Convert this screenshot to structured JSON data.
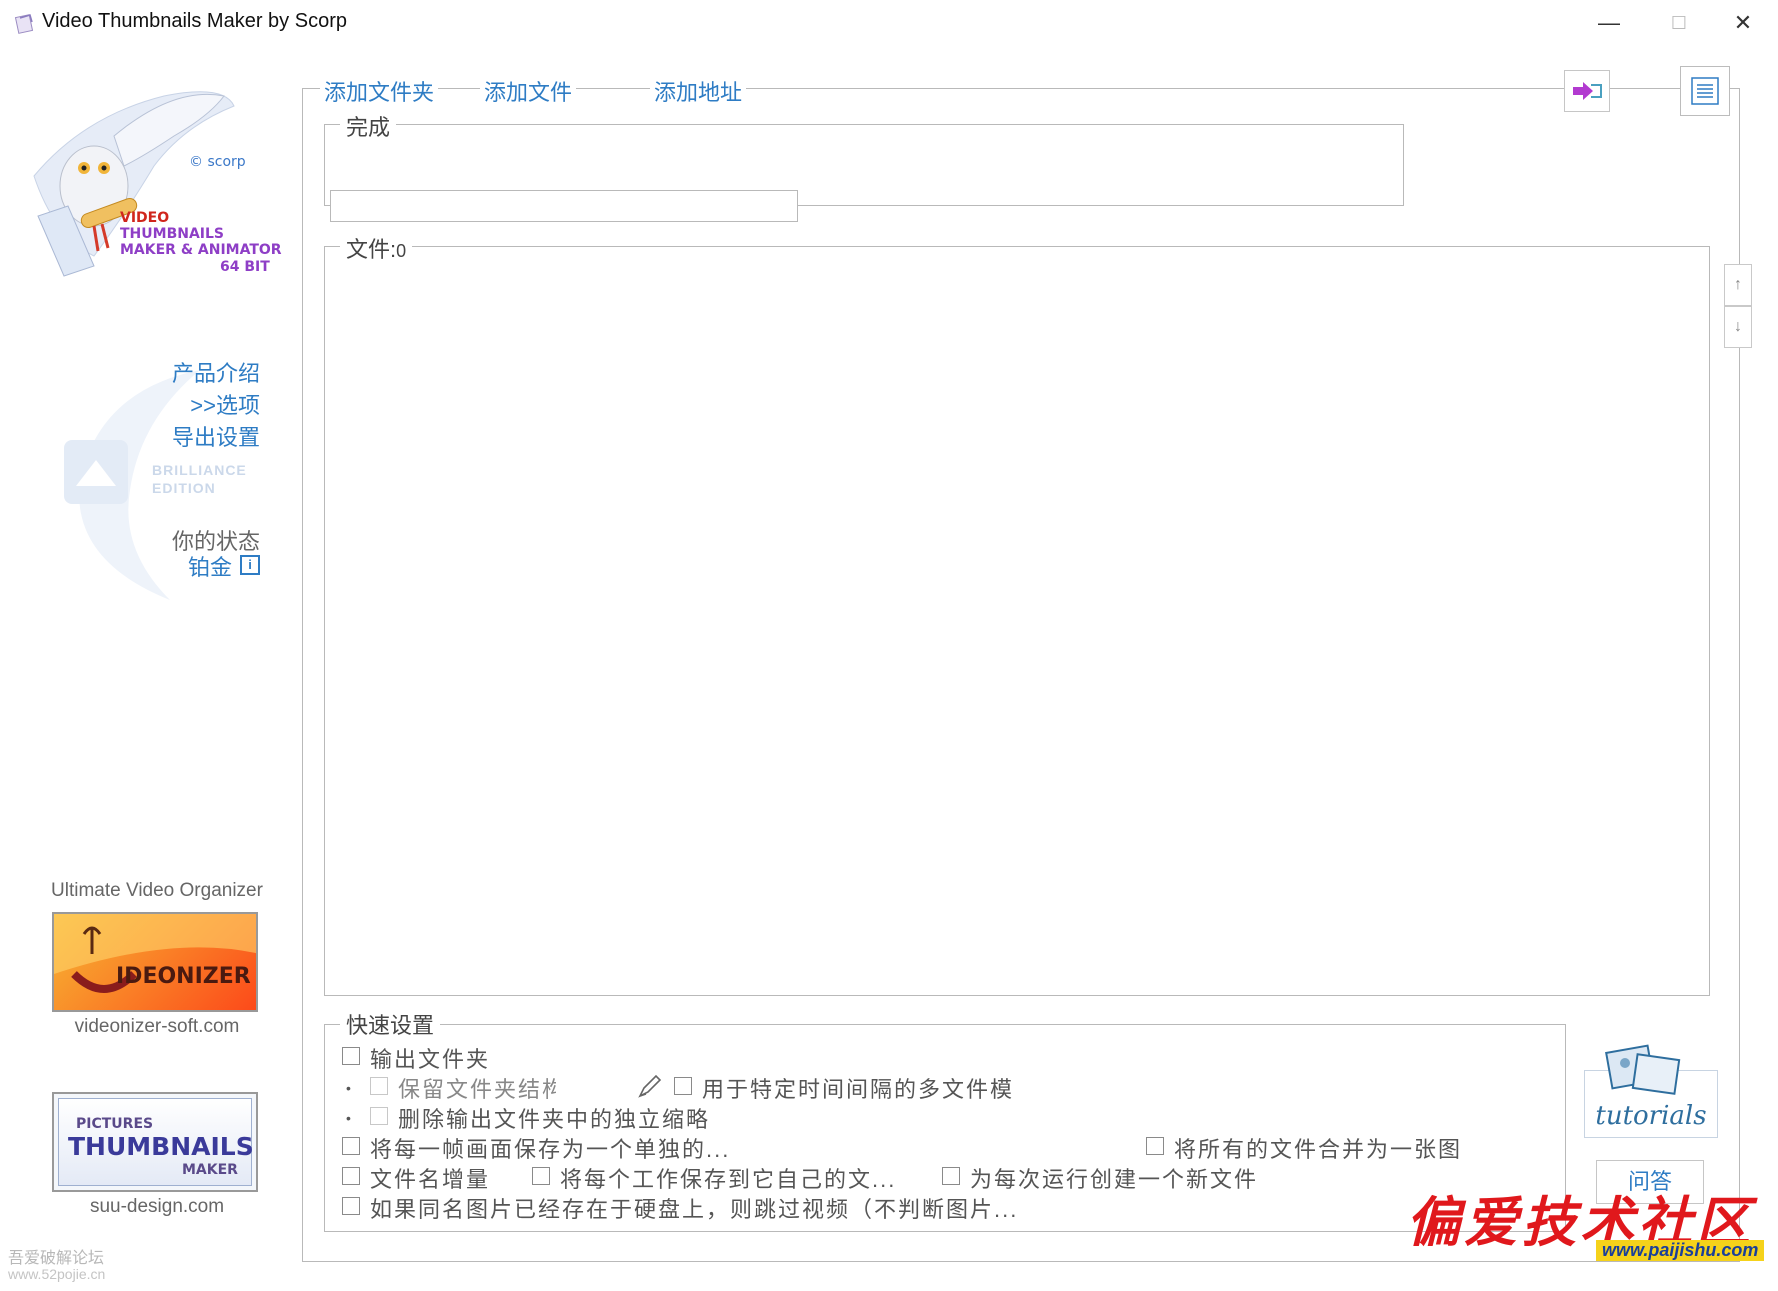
{
  "window": {
    "title": "Video Thumbnails Maker by Scorp",
    "minimize_glyph": "—",
    "maximize_glyph": "☐",
    "close_glyph": "✕"
  },
  "logo": {
    "copyright": "© scorp",
    "line1": "VIDEO",
    "line2": "THUMBNAILS",
    "line3": "MAKER & ANIMATOR",
    "line4": "64 BIT"
  },
  "sidebar": {
    "links": [
      "产品介绍",
      ">>选项",
      "导出设置"
    ],
    "edition_line1": "BRILLIANCE",
    "edition_line2": "EDITION",
    "status_label": "你的状态",
    "status_value": "铂金",
    "info_glyph": "i",
    "promo1": {
      "caption": "Ultimate Video Organizer",
      "banner_text": "IDEONIZER",
      "url": "videonizer-soft.com"
    },
    "promo2": {
      "line1": "PICTURES",
      "line2": "THUMBNAILS",
      "line3": "MAKER",
      "url": "suu-design.com"
    }
  },
  "toolbar": {
    "add_folder": "添加文件夹",
    "add_file": "添加文件",
    "add_url": "添加地址"
  },
  "progress": {
    "legend": "完成",
    "value": 0
  },
  "files": {
    "legend": "文件:",
    "count": "0",
    "up_glyph": "↑",
    "down_glyph": "↓"
  },
  "quick_settings": {
    "legend": "快速设置",
    "output_folder": "输出文件夹",
    "keep_structure": "保留文件夹结构",
    "interval_mode": "用于特定时间间隔的多文件模",
    "delete_thumbs": "删除输出文件夹中的独立缩略",
    "save_each_frame": "将每一帧画面保存为一个单独的...",
    "merge_all": "将所有的文件合并为一张图",
    "filename_increment": "文件名增量",
    "save_each_job": "将每个工作保存到它自己的文...",
    "new_file_each_run": "为每次运行创建一个新文件",
    "skip_existing": "如果同名图片已经存在于硬盘上，则跳过视频（不判断图片..."
  },
  "help": {
    "tutorials": "tutorials",
    "faq": "问答"
  },
  "watermarks": {
    "bottom_left_1": "吾爱破解论坛",
    "bottom_left_2": "www.52pojie.cn",
    "bottom_right_1": "偏爱技术社区",
    "bottom_right_2": "www.paijishu.com"
  },
  "colors": {
    "link": "#2e7cc4",
    "logo_red": "#d0261c",
    "logo_purple": "#8e3ec6"
  }
}
